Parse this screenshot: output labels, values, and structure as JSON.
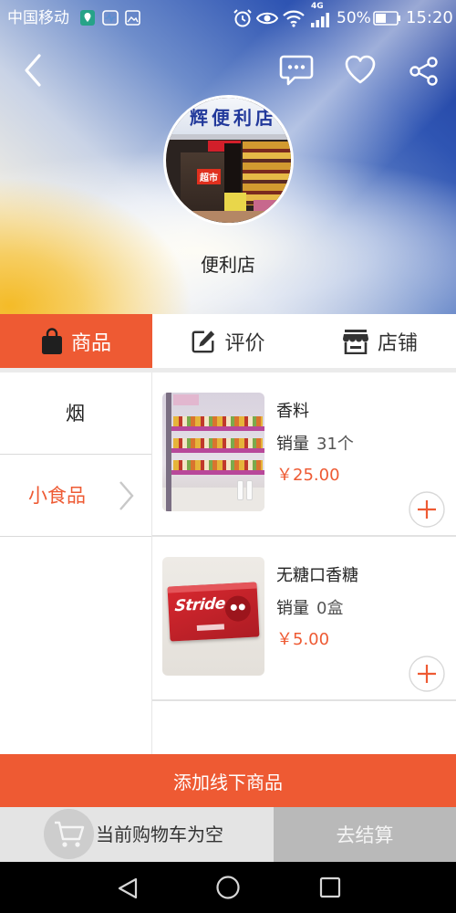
{
  "status_bar": {
    "carrier": "中国移动",
    "network_type": "4G",
    "battery_percent": "50%",
    "battery_level": 0.5,
    "time": "15:20",
    "left_icons": [
      "map-app-icon",
      "health-app-icon",
      "gallery-app-icon"
    ],
    "right_icons": [
      "alarm-icon",
      "eye-icon",
      "wifi-icon",
      "signal-icon",
      "battery-icon"
    ]
  },
  "header": {
    "back_icon": "back-arrow-icon",
    "action_icons": [
      "chat-bubble-icon",
      "heart-icon",
      "share-icon"
    ],
    "store_name": "便利店",
    "avatar_sign": "辉便利店",
    "avatar_small_sign": "超市"
  },
  "tabs": [
    {
      "label": "商品",
      "icon": "shopping-bag-icon",
      "active": true
    },
    {
      "label": "评价",
      "icon": "edit-review-icon",
      "active": false
    },
    {
      "label": "店铺",
      "icon": "store-icon",
      "active": false
    }
  ],
  "categories": [
    {
      "label": "烟",
      "selected": false
    },
    {
      "label": "小食品",
      "selected": true,
      "icon": "chevron-right-icon"
    }
  ],
  "products": [
    {
      "name": "香料",
      "sales_label": "销量",
      "sales_value": "31个",
      "price": "￥25.00",
      "add_icon": "plus-circle-icon"
    },
    {
      "name": "无糖口香糖",
      "sales_label": "销量",
      "sales_value": "0盒",
      "price": "￥5.00",
      "add_icon": "plus-circle-icon",
      "image_brand_text": "Stride"
    }
  ],
  "add_offline_button": "添加线下商品",
  "cart": {
    "icon": "cart-icon",
    "empty_text": "当前购物车为空",
    "checkout_label": "去结算"
  },
  "nav_bar": {
    "icons": [
      "nav-back-icon",
      "nav-home-icon",
      "nav-recents-icon"
    ]
  },
  "colors": {
    "accent": "#ee5a33",
    "text_dark": "#222222",
    "cart_bg": "#e4e4e4",
    "checkout_bg": "#b9b9b9",
    "nav_bg": "#000000"
  }
}
